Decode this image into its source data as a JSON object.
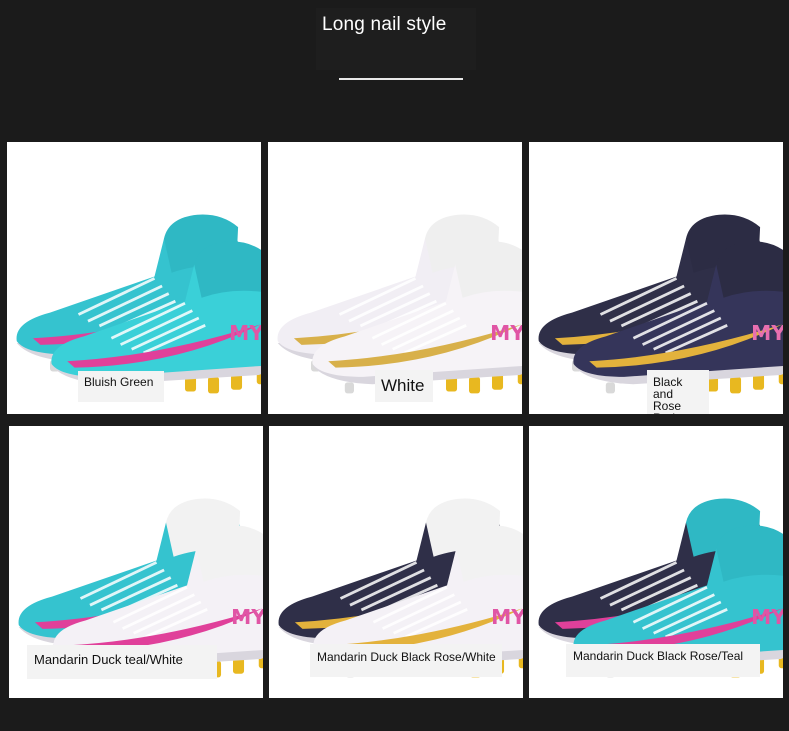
{
  "header": {
    "title": "Long nail style"
  },
  "products": [
    {
      "label": "Bluish Green",
      "upper": "#35c3cf",
      "upper2": "#3ad0d8",
      "collar": "#2fb8c4",
      "swoosh": "#e0409a",
      "sole": "#e8b820",
      "logo": "#e055a5"
    },
    {
      "label": "White",
      "upper": "#f1eef4",
      "upper2": "#f6f3f7",
      "collar": "#efefef",
      "swoosh": "#d8b04a",
      "sole": "#e8b820",
      "logo": "#e055a5"
    },
    {
      "label": "Black and Rose Red",
      "upper": "#2f2f48",
      "upper2": "#35355a",
      "collar": "#2c2c44",
      "swoosh": "#e3b23c",
      "sole": "#e8b820",
      "logo": "#e86fb0"
    },
    {
      "label": "Mandarin Duck teal/White",
      "upper": "#35c3cf",
      "upper2": "#f4f1f6",
      "collar": "#f2f2f2",
      "swoosh": "#e0409a",
      "sole": "#e8b820",
      "logo": "#e055a5"
    },
    {
      "label": "Mandarin Duck Black Rose/White",
      "upper": "#2f2f48",
      "upper2": "#f4f1f6",
      "collar": "#f2f2f2",
      "swoosh": "#e3b23c",
      "sole": "#e8b820",
      "logo": "#e055a5"
    },
    {
      "label": "Mandarin Duck Black Rose/Teal",
      "upper": "#2f2f48",
      "upper2": "#35c3cf",
      "collar": "#2fb8c4",
      "swoosh": "#e0409a",
      "sole": "#e8b820",
      "logo": "#e055a5"
    }
  ]
}
